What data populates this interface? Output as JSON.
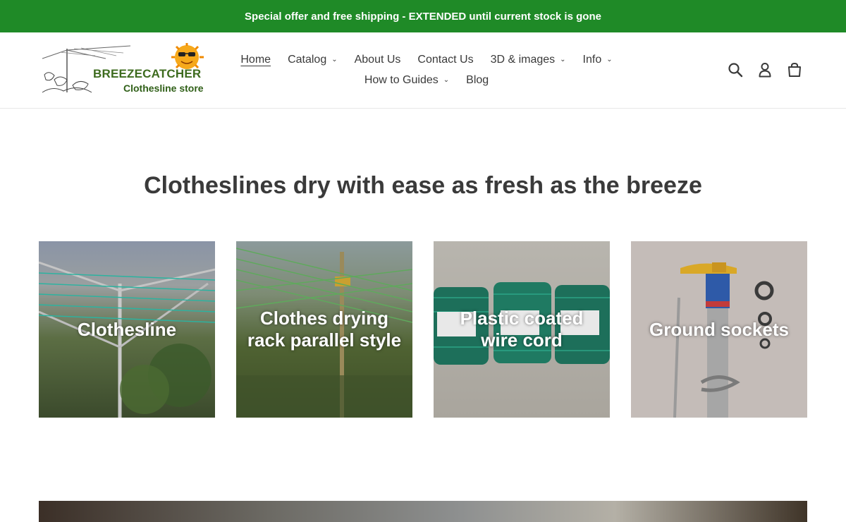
{
  "announcement": {
    "text": "Special offer and free shipping - EXTENDED until current stock is gone"
  },
  "logo": {
    "title": "BREEZECATCHER",
    "subtitle": "Clothesline store"
  },
  "nav": {
    "row1": [
      {
        "label": "Home",
        "active": true,
        "dropdown": false
      },
      {
        "label": "Catalog",
        "dropdown": true
      },
      {
        "label": "About Us",
        "dropdown": false
      },
      {
        "label": "Contact Us",
        "dropdown": false
      },
      {
        "label": "3D & images",
        "dropdown": true
      },
      {
        "label": "Info",
        "dropdown": true
      }
    ],
    "row2": [
      {
        "label": "How to Guides",
        "dropdown": true
      },
      {
        "label": "Blog",
        "dropdown": false
      }
    ]
  },
  "header_icons": [
    "search-icon",
    "account-icon",
    "cart-icon"
  ],
  "main": {
    "heading": "Clotheslines dry with ease as fresh as the breeze"
  },
  "collections": [
    {
      "label": "Clothesline"
    },
    {
      "label": "Clothes drying rack parallel style"
    },
    {
      "label": "Plastic coated wire cord"
    },
    {
      "label": "Ground sockets"
    }
  ],
  "colors": {
    "announcement_bg": "#1f8a27",
    "text": "#3a3a3a",
    "logo_green": "#3d6b1e"
  }
}
